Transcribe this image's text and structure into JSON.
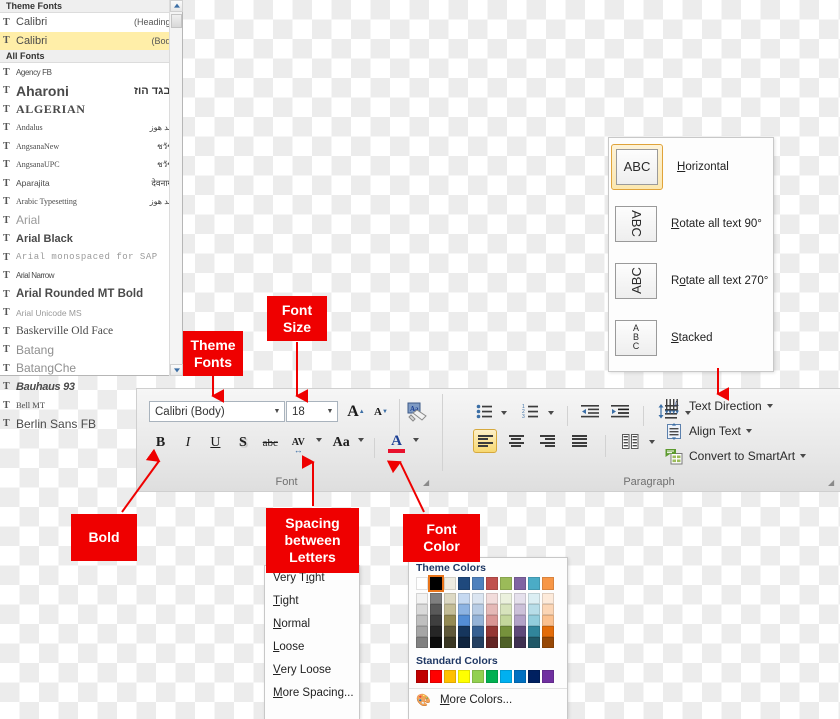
{
  "font_list": {
    "theme_header": "Theme Fonts",
    "all_header": "All Fonts",
    "theme_fonts": [
      {
        "name": "Calibri",
        "tag": "(Headings)",
        "selected": false
      },
      {
        "name": "Calibri",
        "tag": "(Body)",
        "selected": true
      }
    ],
    "all_fonts": [
      {
        "name": "Agency FB",
        "sample": ""
      },
      {
        "name": "Aharoni",
        "sample": "אבגד הוז"
      },
      {
        "name": "ALGERIAN",
        "sample": ""
      },
      {
        "name": "Andalus",
        "sample": "أبجد هوز"
      },
      {
        "name": "AngsanaNew",
        "sample": "ชวัชนี"
      },
      {
        "name": "AngsanaUPC",
        "sample": "ชวัชนี"
      },
      {
        "name": "Aparajita",
        "sample": "देवनागरी"
      },
      {
        "name": "Arabic Typesetting",
        "sample": "أبجد هوز"
      },
      {
        "name": "Arial",
        "sample": ""
      },
      {
        "name": "Arial Black",
        "sample": ""
      },
      {
        "name": "Arial monospaced for SAP",
        "sample": ""
      },
      {
        "name": "Arial Narrow",
        "sample": ""
      },
      {
        "name": "Arial Rounded MT Bold",
        "sample": ""
      },
      {
        "name": "Arial Unicode MS",
        "sample": ""
      },
      {
        "name": "Baskerville Old Face",
        "sample": ""
      },
      {
        "name": "Batang",
        "sample": ""
      },
      {
        "name": "BatangChe",
        "sample": ""
      },
      {
        "name": "Bauhaus 93",
        "sample": ""
      },
      {
        "name": "Bell MT",
        "sample": ""
      },
      {
        "name": "Berlin Sans FB",
        "sample": ""
      }
    ]
  },
  "text_direction": {
    "items": [
      {
        "label": "Horizontal",
        "underline_index": 0,
        "glyph": "ABC",
        "orientation": "horizontal",
        "selected": true
      },
      {
        "label": "Rotate all text 90°",
        "underline_index": 0,
        "glyph": "ABC",
        "orientation": "rotate90",
        "selected": false
      },
      {
        "label": "Rotate all text 270°",
        "underline_index": 2,
        "glyph": "ABC",
        "orientation": "rotate270",
        "selected": false
      },
      {
        "label": "Stacked",
        "underline_index": 0,
        "glyph": "A\nB\nC",
        "orientation": "stacked",
        "selected": false
      }
    ]
  },
  "ribbon": {
    "font_group": {
      "label": "Font",
      "font_name_value": "Calibri (Body)",
      "font_size_value": "18",
      "buttons": [
        {
          "name": "grow-font",
          "label": "A"
        },
        {
          "name": "shrink-font",
          "label": "A"
        },
        {
          "name": "clear-formatting",
          "label": "Aa"
        },
        {
          "name": "bold",
          "label": "B"
        },
        {
          "name": "italic",
          "label": "I"
        },
        {
          "name": "underline",
          "label": "U"
        },
        {
          "name": "text-shadow",
          "label": "S"
        },
        {
          "name": "strikethrough",
          "label": "abc"
        },
        {
          "name": "character-spacing",
          "label": "AV"
        },
        {
          "name": "change-case",
          "label": "Aa"
        },
        {
          "name": "font-color",
          "label": "A"
        }
      ]
    },
    "paragraph_group": {
      "label": "Paragraph",
      "text_direction_label": "Text Direction",
      "align_text_label": "Align Text",
      "convert_smartart_label": "Convert to SmartArt"
    }
  },
  "spacing_menu": {
    "items": [
      {
        "label": "Very Tight",
        "underline_index": 6
      },
      {
        "label": "Tight",
        "underline_index": 0
      },
      {
        "label": "Normal",
        "underline_index": 0
      },
      {
        "label": "Loose",
        "underline_index": 0
      },
      {
        "label": "Very Loose",
        "underline_index": 0
      },
      {
        "label": "More Spacing...",
        "underline_index": 0
      }
    ]
  },
  "color_menu": {
    "theme_title": "Theme Colors",
    "standard_title": "Standard Colors",
    "more_colors_label": "More Colors...",
    "selected_swatch": {
      "column": 1,
      "row": 0,
      "hex": "#000000"
    },
    "theme_columns": [
      [
        "#ffffff",
        "#f2f2f2",
        "#d9d9d9",
        "#bfbfbf",
        "#a6a6a6",
        "#808080"
      ],
      [
        "#000000",
        "#7f7f7f",
        "#595959",
        "#3f3f3f",
        "#262626",
        "#0c0c0c"
      ],
      [
        "#eeece1",
        "#ddd9c4",
        "#c4bd97",
        "#948a54",
        "#60593a",
        "#3a3723"
      ],
      [
        "#1f497d",
        "#c6d9f1",
        "#8db3e2",
        "#538dd5",
        "#16365d",
        "#0f243e"
      ],
      [
        "#4f81bd",
        "#dbe5f1",
        "#b8cce4",
        "#95b3d7",
        "#366092",
        "#244061"
      ],
      [
        "#c0504d",
        "#f2dcdb",
        "#e5b9b7",
        "#d99694",
        "#953734",
        "#632423"
      ],
      [
        "#9bbb59",
        "#ebf1dd",
        "#d7e3bc",
        "#c3d69b",
        "#76923c",
        "#4f6128"
      ],
      [
        "#8064a2",
        "#e5e0ec",
        "#ccc1d9",
        "#b2a2c7",
        "#5f497a",
        "#3f3151"
      ],
      [
        "#4bacc6",
        "#dbeef3",
        "#b7dde8",
        "#92cddc",
        "#31859b",
        "#205867"
      ],
      [
        "#f79646",
        "#fdeada",
        "#fbd5b5",
        "#fac08f",
        "#e36c09",
        "#974806"
      ]
    ],
    "standard_colors": [
      "#c00000",
      "#ff0000",
      "#ffc000",
      "#ffff00",
      "#92d050",
      "#00b050",
      "#00b0f0",
      "#0070c0",
      "#002060",
      "#7030a0"
    ]
  },
  "callouts": [
    {
      "name": "theme-fonts",
      "lines": [
        "Theme",
        "Fonts"
      ]
    },
    {
      "name": "font-size",
      "lines": [
        "Font",
        "Size"
      ]
    },
    {
      "name": "bold",
      "lines": [
        "Bold"
      ]
    },
    {
      "name": "spacing-between-letters",
      "lines": [
        "Spacing",
        "between",
        "Letters"
      ]
    },
    {
      "name": "font-color",
      "lines": [
        "Font",
        "Color"
      ]
    }
  ],
  "accent_color": "#ef0000"
}
